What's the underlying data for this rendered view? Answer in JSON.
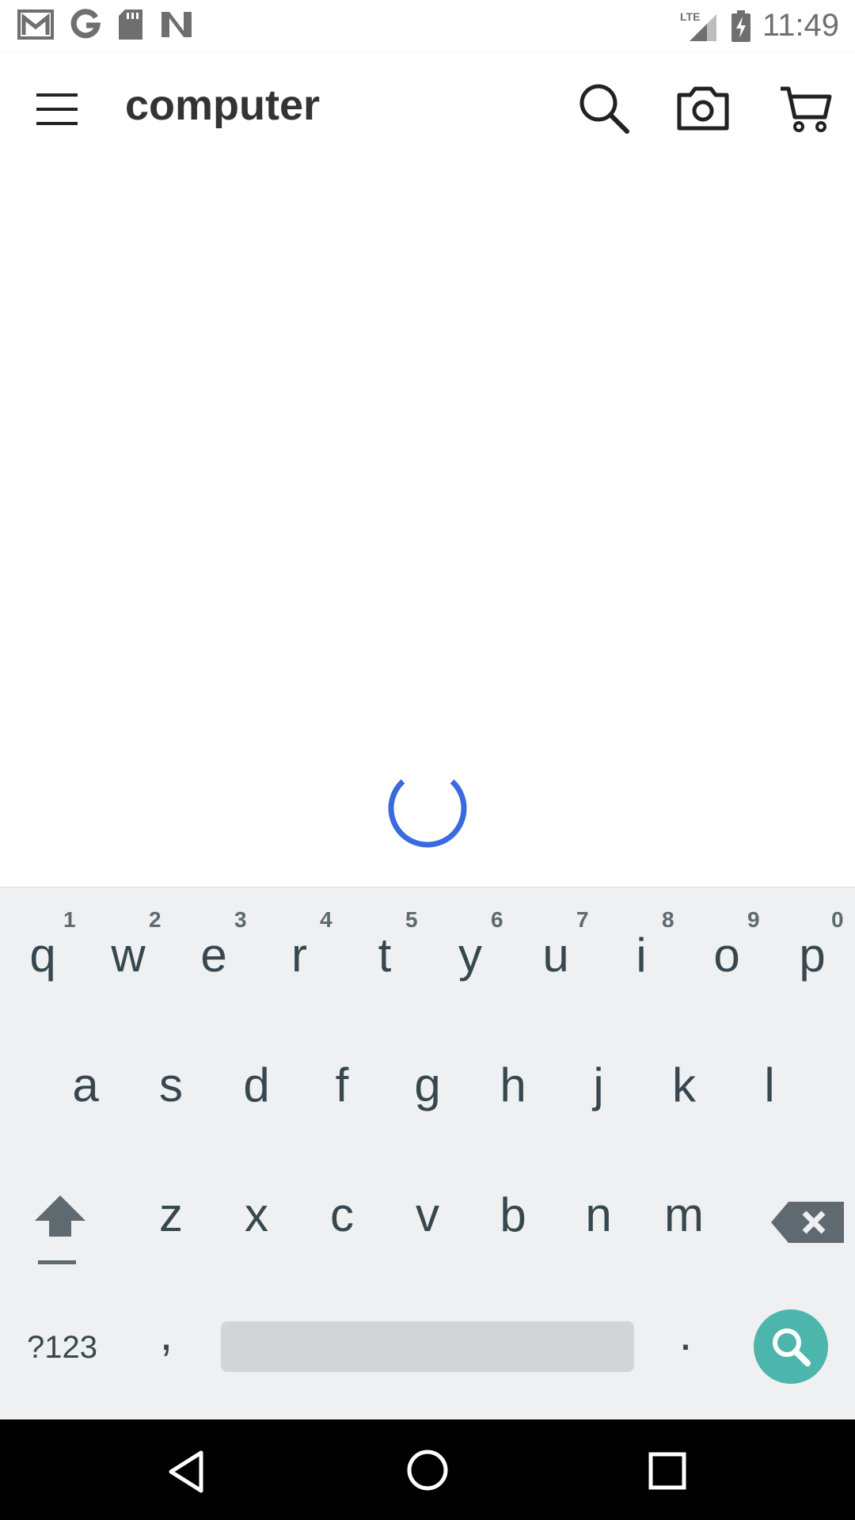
{
  "status_bar": {
    "time": "11:49",
    "network": "LTE",
    "notification_icons": [
      "gmail-icon",
      "google-icon",
      "sd-card-icon",
      "n-app-icon"
    ]
  },
  "app_bar": {
    "search_query": "computer",
    "icons": [
      "menu-icon",
      "search-icon",
      "camera-icon",
      "cart-icon"
    ]
  },
  "keyboard": {
    "row1": [
      "q",
      "w",
      "e",
      "r",
      "t",
      "y",
      "u",
      "i",
      "o",
      "p"
    ],
    "row1_hints": [
      "1",
      "2",
      "3",
      "4",
      "5",
      "6",
      "7",
      "8",
      "9",
      "0"
    ],
    "row2": [
      "a",
      "s",
      "d",
      "f",
      "g",
      "h",
      "j",
      "k",
      "l"
    ],
    "row3": [
      "z",
      "x",
      "c",
      "v",
      "b",
      "n",
      "m"
    ],
    "symbols_label": "?123",
    "comma": ",",
    "period": ".",
    "accent_color": "#4db6ac"
  },
  "spinner_color": "#3b6ae0"
}
